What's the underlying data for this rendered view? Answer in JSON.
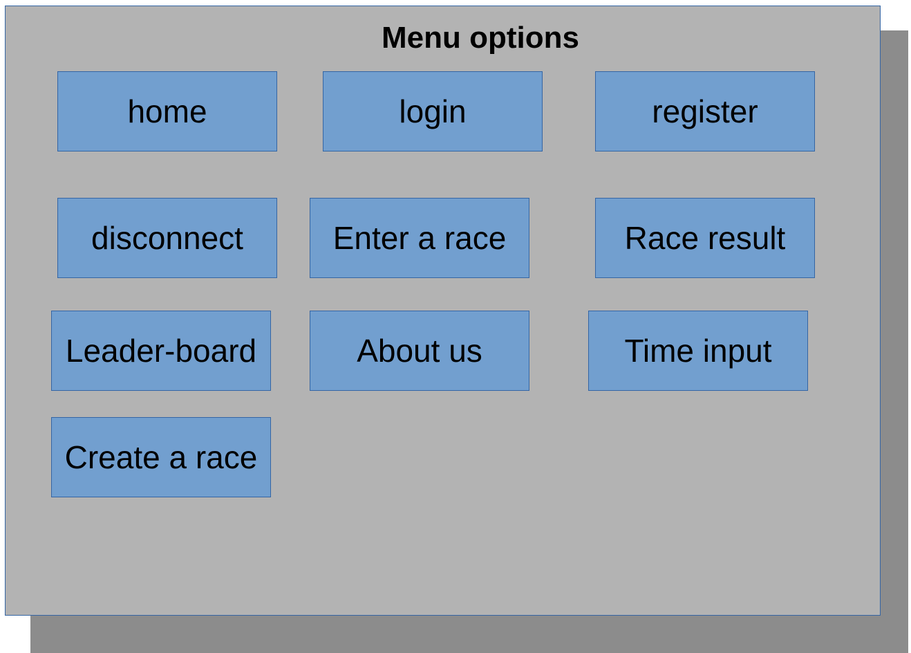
{
  "panel": {
    "title": "Menu options"
  },
  "buttons": {
    "home": "home",
    "login": "login",
    "register": "register",
    "disconnect": "disconnect",
    "enter_race": "Enter a race",
    "race_result": "Race result",
    "leader_board": "Leader-board",
    "about_us": "About us",
    "time_input": "Time input",
    "create_race": "Create a race"
  },
  "colors": {
    "panel_fill": "#b3b3b3",
    "shadow": "#8c8c8c",
    "button_fill": "#729fcf",
    "border": "#3465a4"
  }
}
